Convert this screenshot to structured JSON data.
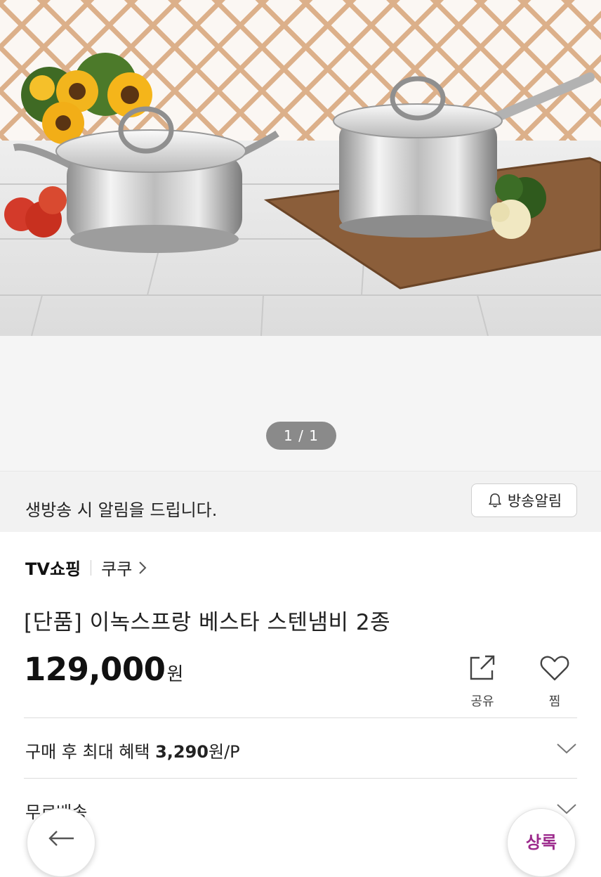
{
  "gallery": {
    "image_alt": "stainless pot set product photo",
    "pager": "1 / 1"
  },
  "alert": {
    "text": "생방송 시 알림을 드립니다.",
    "button_label": "방송알림"
  },
  "breadcrumb": {
    "channel": "TV쇼핑",
    "brand": "쿠쿠"
  },
  "product": {
    "title": "[단품] 이녹스프랑 베스타 스텐냄비 2종",
    "price": "129,000",
    "price_unit": "원"
  },
  "actions": {
    "share_label": "공유",
    "like_label": "찜"
  },
  "benefit": {
    "prefix": "구매 후 최대 혜택 ",
    "amount": "3,290",
    "suffix": "원/P"
  },
  "shipping": {
    "label": "무료배송"
  },
  "floating": {
    "buy_label": "상록"
  }
}
